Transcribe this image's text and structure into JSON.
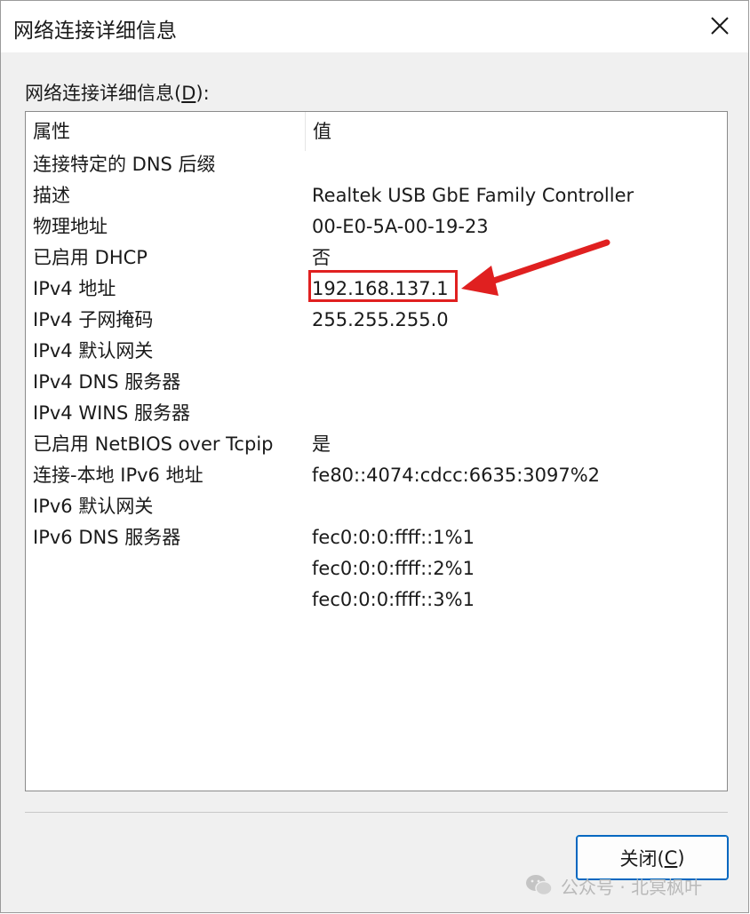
{
  "window": {
    "title": "网络连接详细信息"
  },
  "group_label": {
    "prefix": "网络连接详细信息(",
    "accel": "D",
    "suffix": "):"
  },
  "table": {
    "columns": [
      "属性",
      "值"
    ],
    "rows": [
      {
        "property": "连接特定的 DNS 后缀",
        "value": ""
      },
      {
        "property": "描述",
        "value": "Realtek USB GbE Family Controller"
      },
      {
        "property": "物理地址",
        "value": "00-E0-5A-00-19-23"
      },
      {
        "property": "已启用 DHCP",
        "value": "否"
      },
      {
        "property": "IPv4 地址",
        "value": "192.168.137.1"
      },
      {
        "property": "IPv4 子网掩码",
        "value": "255.255.255.0"
      },
      {
        "property": "IPv4 默认网关",
        "value": ""
      },
      {
        "property": "IPv4 DNS 服务器",
        "value": ""
      },
      {
        "property": "IPv4 WINS 服务器",
        "value": ""
      },
      {
        "property": "已启用 NetBIOS over Tcpip",
        "value": "是"
      },
      {
        "property": "连接-本地 IPv6 地址",
        "value": "fe80::4074:cdcc:6635:3097%2"
      },
      {
        "property": "IPv6 默认网关",
        "value": ""
      },
      {
        "property": "IPv6 DNS 服务器",
        "value": "fec0:0:0:ffff::1%1"
      },
      {
        "property": "",
        "value": "fec0:0:0:ffff::2%1"
      },
      {
        "property": "",
        "value": "fec0:0:0:ffff::3%1"
      }
    ]
  },
  "buttons": {
    "close_prefix": "关闭(",
    "close_accel": "C",
    "close_suffix": ")"
  },
  "watermark": {
    "text": "公众号 · 北冥枫叶"
  },
  "colors": {
    "annotation": "#e02020",
    "button_border": "#0067c0"
  },
  "icons": {
    "close": "close-icon",
    "annotation_arrow": "arrow-icon",
    "watermark": "wechat-icon"
  }
}
